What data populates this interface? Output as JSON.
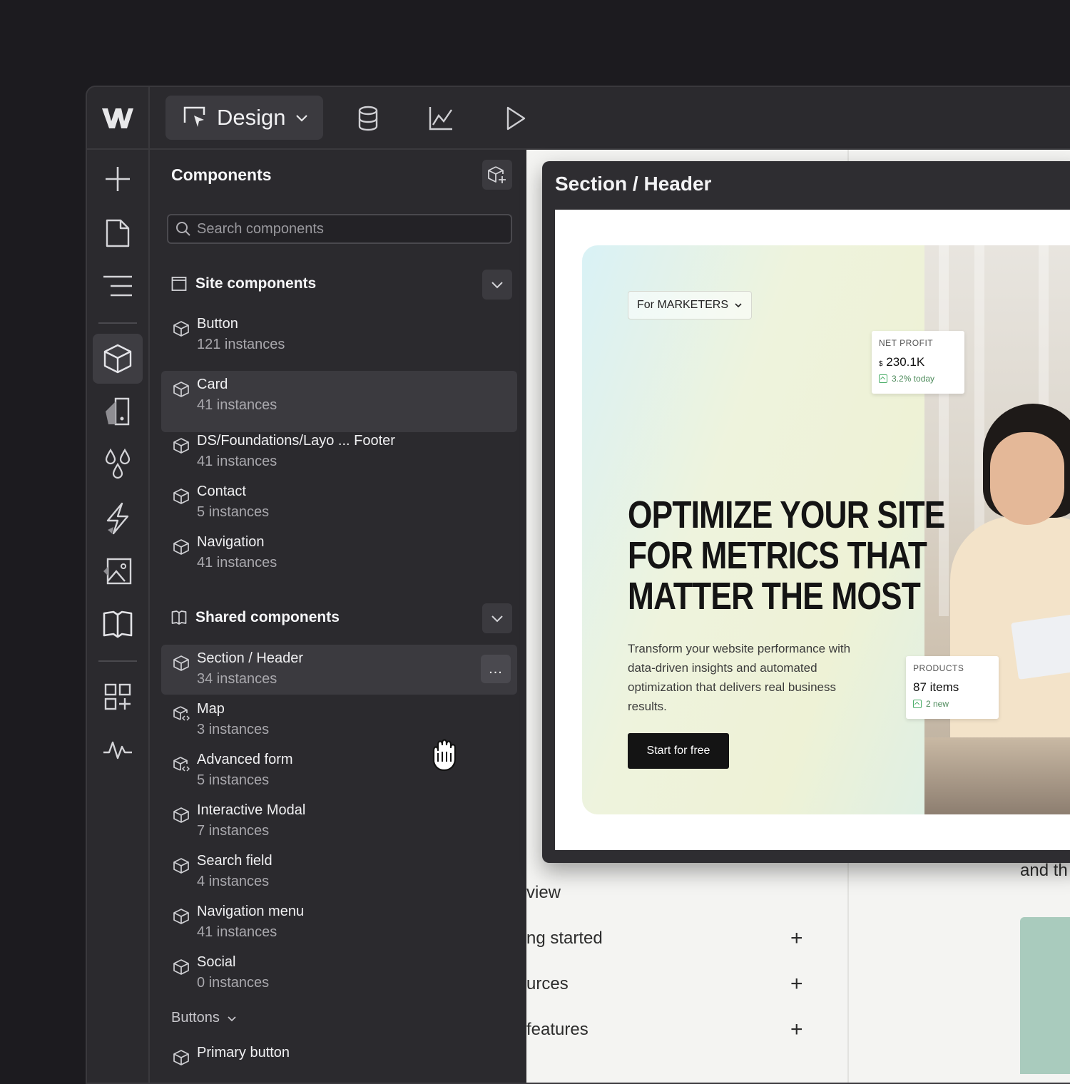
{
  "toolbar": {
    "mode_label": "Design",
    "icons": [
      "webflow-logo",
      "cms-database-icon",
      "analytics-chart-icon",
      "preview-play-icon"
    ]
  },
  "sidebar_icons": [
    "add-icon",
    "pages-icon",
    "navigator-icon",
    "components-icon",
    "variables-icon",
    "styles-icon",
    "interactions-icon",
    "assets-icon",
    "library-icon",
    "apps-icon",
    "audit-icon"
  ],
  "panel": {
    "title": "Components",
    "search_placeholder": "Search components",
    "site_group": {
      "label": "Site components",
      "items": [
        {
          "name": "Button",
          "count": "121 instances"
        },
        {
          "name": "Card",
          "count": "41 instances"
        },
        {
          "name": "DS/Foundations/Layo ... Footer",
          "count": "41 instances"
        },
        {
          "name": "Contact",
          "count": "5 instances"
        },
        {
          "name": "Navigation",
          "count": "41 instances"
        }
      ]
    },
    "shared_group": {
      "label": "Shared components",
      "items": [
        {
          "name": "Section / Header",
          "count": "34 instances"
        },
        {
          "name": "Map",
          "count": "3 instances"
        },
        {
          "name": "Advanced form",
          "count": "5 instances"
        },
        {
          "name": "Interactive Modal",
          "count": "7 instances"
        },
        {
          "name": "Search field",
          "count": "4 instances"
        },
        {
          "name": "Navigation menu",
          "count": "41 instances"
        },
        {
          "name": "Social",
          "count": "0 instances"
        }
      ]
    },
    "buttons_group": {
      "label": "Buttons",
      "items": [
        {
          "name": "Primary button"
        }
      ]
    },
    "more_label": "..."
  },
  "preview": {
    "title": "Section / Header",
    "dropdown": "For MARKETERS",
    "headline": [
      "OPTIMIZE YOUR SITE",
      "FOR METRICS THAT",
      "MATTER THE MOST"
    ],
    "body": "Transform your website performance with data-driven insights and automated optimization that delivers real business results.",
    "cta": "Start for free",
    "net_profit": {
      "label": "NET PROFIT",
      "currency": "$",
      "value": "230.1K",
      "change": "3.2% today"
    },
    "products": {
      "label": "PRODUCTS",
      "value": "87 items",
      "change": "2 new"
    }
  },
  "canvas": {
    "behind_fragments": [
      "view",
      "ng started",
      "urces",
      "features",
      "and th"
    ],
    "plus": "+"
  },
  "colors": {
    "bg": "#1c1b1f",
    "panel": "#2b2a2e",
    "highlight": "#3b3a3f",
    "cta": "#141414"
  }
}
